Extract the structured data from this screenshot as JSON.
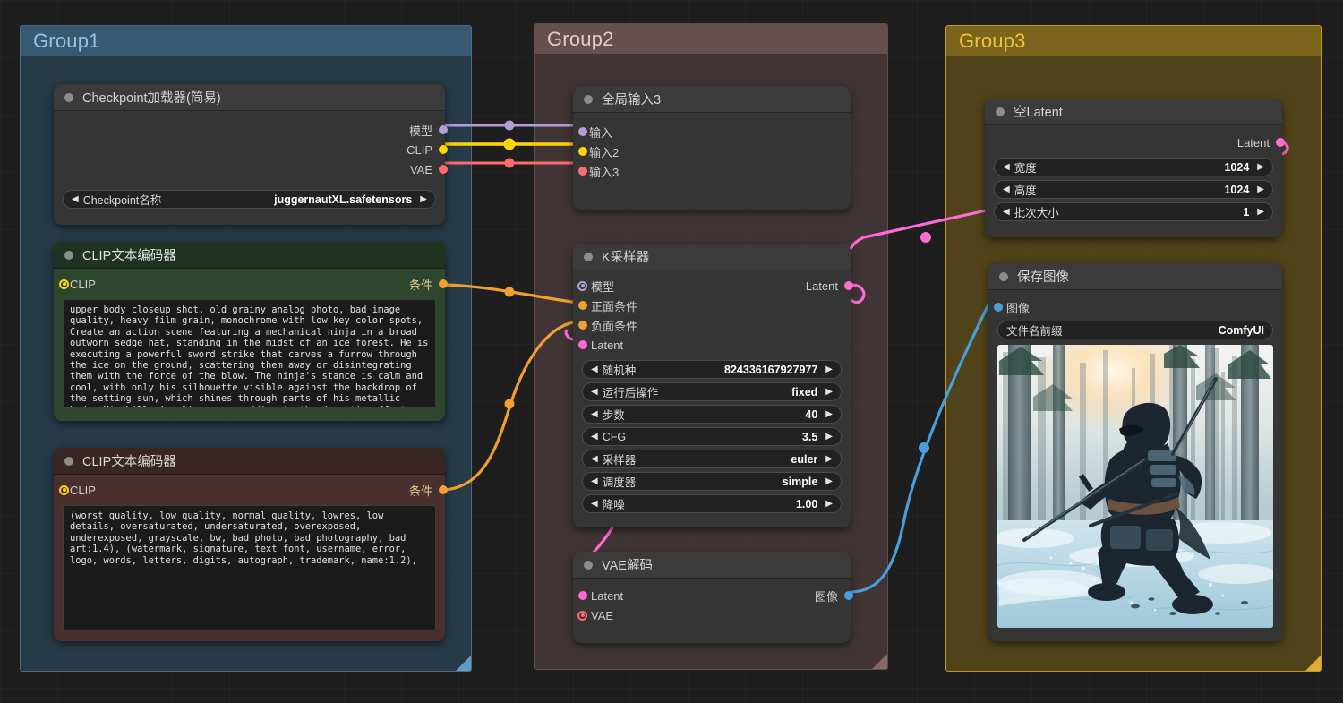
{
  "groups": [
    {
      "id": "group1",
      "title": "Group1"
    },
    {
      "id": "group2",
      "title": "Group2"
    },
    {
      "id": "group3",
      "title": "Group3"
    }
  ],
  "nodes": {
    "checkpoint_loader": {
      "title": "Checkpoint加载器(简易)",
      "outputs": [
        {
          "label": "模型",
          "color": "#b39ddb"
        },
        {
          "label": "CLIP",
          "color": "#ffd500"
        },
        {
          "label": "VAE",
          "color": "#ff6b6b"
        }
      ],
      "widgets": [
        {
          "name": "Checkpoint名称",
          "value": "juggernautXL.safetensors"
        }
      ]
    },
    "clip_positive": {
      "title": "CLIP文本编码器",
      "input": {
        "label": "CLIP",
        "color": "#ffd500"
      },
      "output": {
        "label": "条件",
        "color": "#f0a030"
      },
      "text": "upper body closeup shot, old grainy analog photo, bad image quality, heavy film grain, monochrome with low key color spots, Create an action scene featuring a mechanical ninja in a broad outworn sedge hat, standing in the midst of an ice forest. He is executing a powerful sword strike that carves a furrow through the ice on the ground, scattering them away or disintegrating them with the force of the blow. The ninja's stance is calm and cool, with only his silhouette visible against the backdrop of the setting sun, which shines through parts of his metallic body. His billowing linen cape adding to the dramatic effect. The scene is"
    },
    "clip_negative": {
      "title": "CLIP文本编码器",
      "input": {
        "label": "CLIP",
        "color": "#ffd500"
      },
      "output": {
        "label": "条件",
        "color": "#f0a030"
      },
      "text": "(worst quality, low quality, normal quality, lowres, low details, oversaturated, undersaturated, overexposed, underexposed, grayscale, bw, bad photo, bad photography, bad art:1.4), (watermark, signature, text font, username, error, logo, words, letters, digits, autograph, trademark, name:1.2),"
    },
    "global_input": {
      "title": "全局输入3",
      "inputs": [
        {
          "label": "输入",
          "color": "#b39ddb"
        },
        {
          "label": "输入2",
          "color": "#ffd500"
        },
        {
          "label": "输入3",
          "color": "#ff6b6b"
        }
      ]
    },
    "ksampler": {
      "title": "K采样器",
      "inputs": [
        {
          "label": "模型",
          "color": "#b39ddb",
          "style": "ring"
        },
        {
          "label": "正面条件",
          "color": "#f0a030",
          "style": "solid"
        },
        {
          "label": "负面条件",
          "color": "#f0a030",
          "style": "solid"
        },
        {
          "label": "Latent",
          "color": "#ff6ad5",
          "style": "solid"
        }
      ],
      "outputs": [
        {
          "label": "Latent",
          "color": "#ff6ad5"
        }
      ],
      "widgets": [
        {
          "name": "随机种",
          "value": "824336167927977"
        },
        {
          "name": "运行后操作",
          "value": "fixed"
        },
        {
          "name": "步数",
          "value": "40"
        },
        {
          "name": "CFG",
          "value": "3.5"
        },
        {
          "name": "采样器",
          "value": "euler"
        },
        {
          "name": "调度器",
          "value": "simple"
        },
        {
          "name": "降噪",
          "value": "1.00"
        }
      ]
    },
    "vae_decode": {
      "title": "VAE解码",
      "inputs": [
        {
          "label": "Latent",
          "color": "#ff6ad5",
          "style": "solid"
        },
        {
          "label": "VAE",
          "color": "#ff6b6b",
          "style": "ring"
        }
      ],
      "outputs": [
        {
          "label": "图像",
          "color": "#4a9eda"
        }
      ]
    },
    "empty_latent": {
      "title": "空Latent",
      "outputs": [
        {
          "label": "Latent",
          "color": "#ff6ad5"
        }
      ],
      "widgets": [
        {
          "name": "宽度",
          "value": "1024"
        },
        {
          "name": "高度",
          "value": "1024"
        },
        {
          "name": "批次大小",
          "value": "1"
        }
      ]
    },
    "save_image": {
      "title": "保存图像",
      "inputs": [
        {
          "label": "图像",
          "color": "#4a9eda",
          "style": "solid"
        }
      ],
      "widgets": [
        {
          "name": "文件名前缀",
          "value": "ComfyUI"
        }
      ],
      "preview_alt": "mechanical ninja with sword in snowy forest at sunrise"
    }
  },
  "link_colors": {
    "model": "#b39ddb",
    "clip": "#ffd500",
    "vae": "#ff6b6b",
    "conditioning": "#f0a030",
    "latent": "#ff6ad5",
    "image": "#4a9eda"
  }
}
